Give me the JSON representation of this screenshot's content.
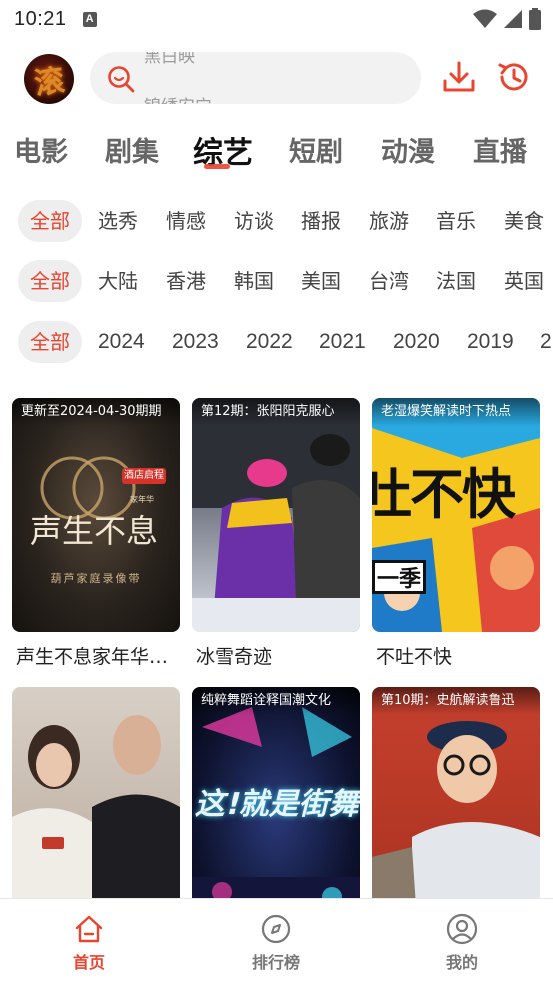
{
  "status_bar": {
    "time": "10:21",
    "notification_letter": "A"
  },
  "search": {
    "rolling_keywords": [
      "黑白映",
      "锦绣安宁"
    ],
    "avatar_glyph": "滚"
  },
  "categories": [
    {
      "label": "电影",
      "active": false
    },
    {
      "label": "剧集",
      "active": false
    },
    {
      "label": "综艺",
      "active": true
    },
    {
      "label": "短剧",
      "active": false
    },
    {
      "label": "动漫",
      "active": false
    },
    {
      "label": "直播",
      "active": false
    }
  ],
  "filters": {
    "type": [
      "全部",
      "选秀",
      "情感",
      "访谈",
      "播报",
      "旅游",
      "音乐",
      "美食"
    ],
    "region": [
      "全部",
      "大陆",
      "香港",
      "韩国",
      "美国",
      "台湾",
      "法国",
      "英国"
    ],
    "year": [
      "全部",
      "2024",
      "2023",
      "2022",
      "2021",
      "2020",
      "2019",
      "2"
    ]
  },
  "cards": [
    {
      "badge": "更新至2024-04-30期期",
      "title": "声生不息家年华…",
      "poster_text": "声生不息",
      "poster_sub": "葫芦家庭录像带",
      "poster_tag": "酒店启程"
    },
    {
      "badge": "第12期：张阳阳克服心",
      "title": "冰雪奇迹"
    },
    {
      "badge": "老湿爆笑解读时下热点",
      "title": "不吐不快",
      "poster_text": "吐不快",
      "poster_sub": "一季"
    },
    {
      "badge": "",
      "title": ""
    },
    {
      "badge": "纯粹舞蹈诠释国潮文化",
      "title": "",
      "poster_text": "这!就是街舞"
    },
    {
      "badge": "第10期：史航解读鲁迅",
      "title": ""
    }
  ],
  "bottom_nav": [
    {
      "label": "首页",
      "icon": "home-icon",
      "active": true
    },
    {
      "label": "排行榜",
      "icon": "compass-icon",
      "active": false
    },
    {
      "label": "我的",
      "icon": "user-icon",
      "active": false
    }
  ],
  "colors": {
    "accent": "#e8442f",
    "tab_inactive": "#666666",
    "filter_bg": "#eeeeee"
  }
}
